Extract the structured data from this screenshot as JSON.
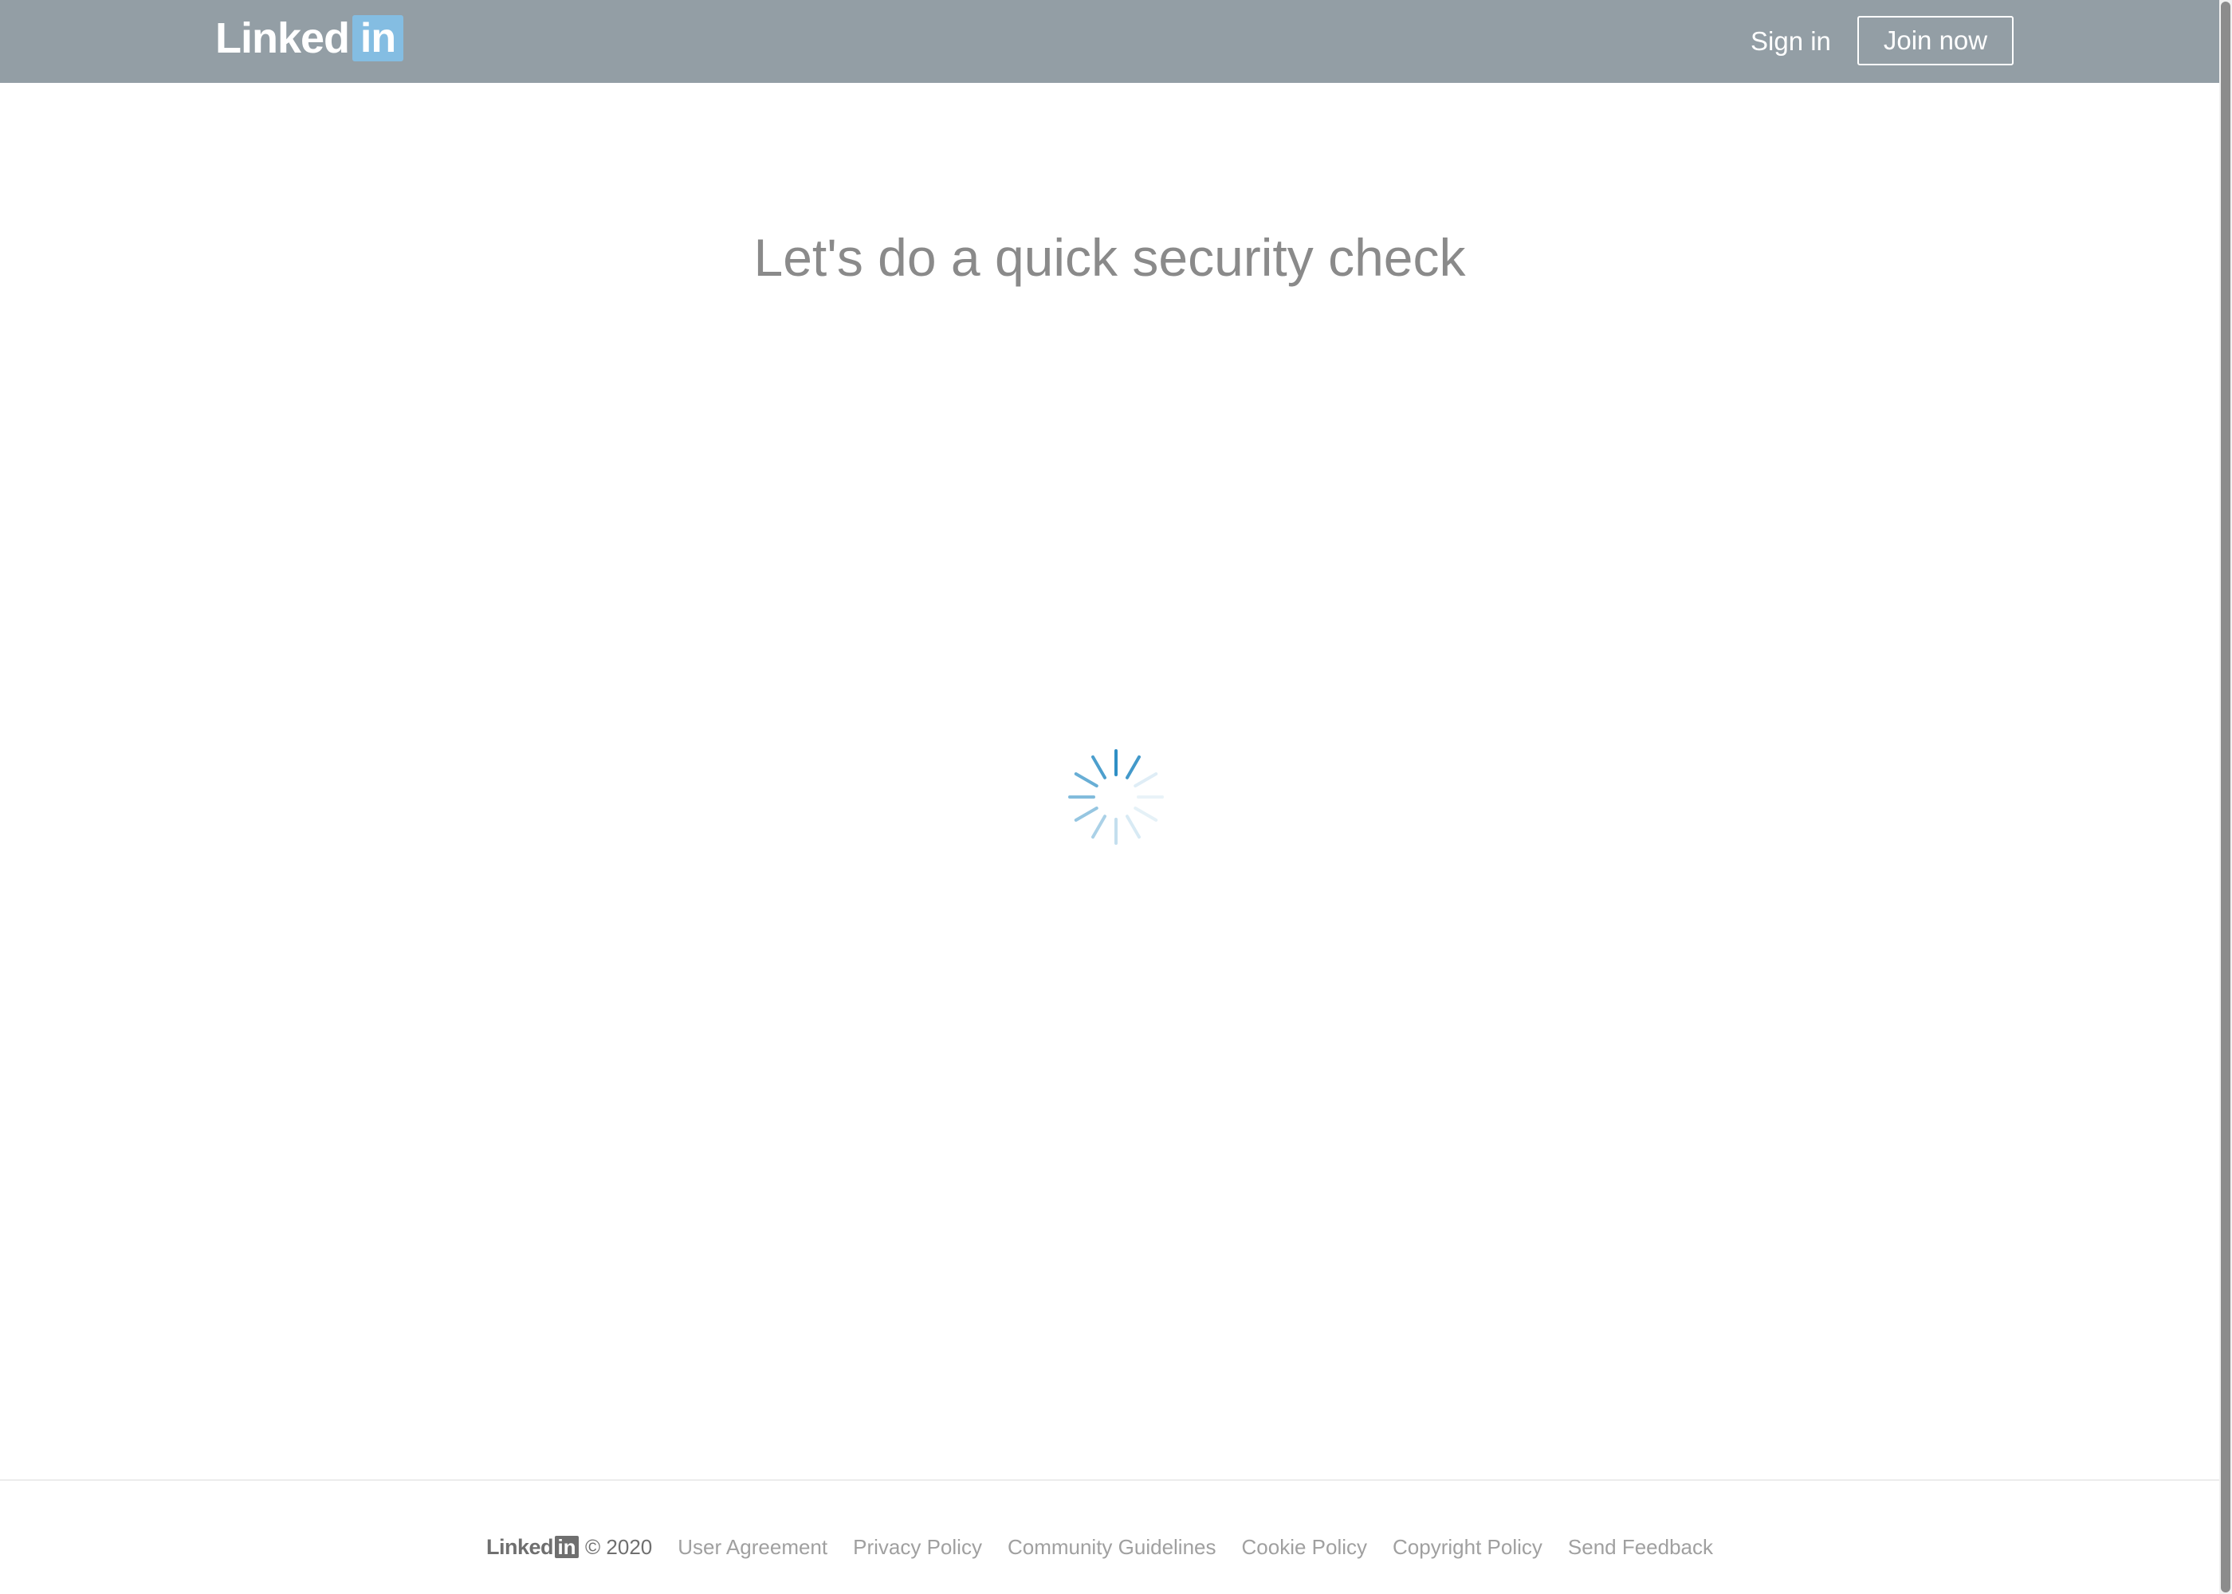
{
  "header": {
    "logo_word": "Linked",
    "logo_box": "in",
    "signin_label": "Sign in",
    "joinnow_label": "Join now"
  },
  "main": {
    "title": "Let's do a quick security check",
    "spinner_color": "#2f8fc5"
  },
  "footer": {
    "logo_word": "Linked",
    "logo_box": "in",
    "copyright": "© 2020",
    "links": [
      "User Agreement",
      "Privacy Policy",
      "Community Guidelines",
      "Cookie Policy",
      "Copyright Policy",
      "Send Feedback"
    ]
  },
  "colors": {
    "header_bg": "#939ea5",
    "logo_box_bg": "#84bde2",
    "title_text": "#8a8a8a",
    "footer_link": "#a0a0a0"
  }
}
